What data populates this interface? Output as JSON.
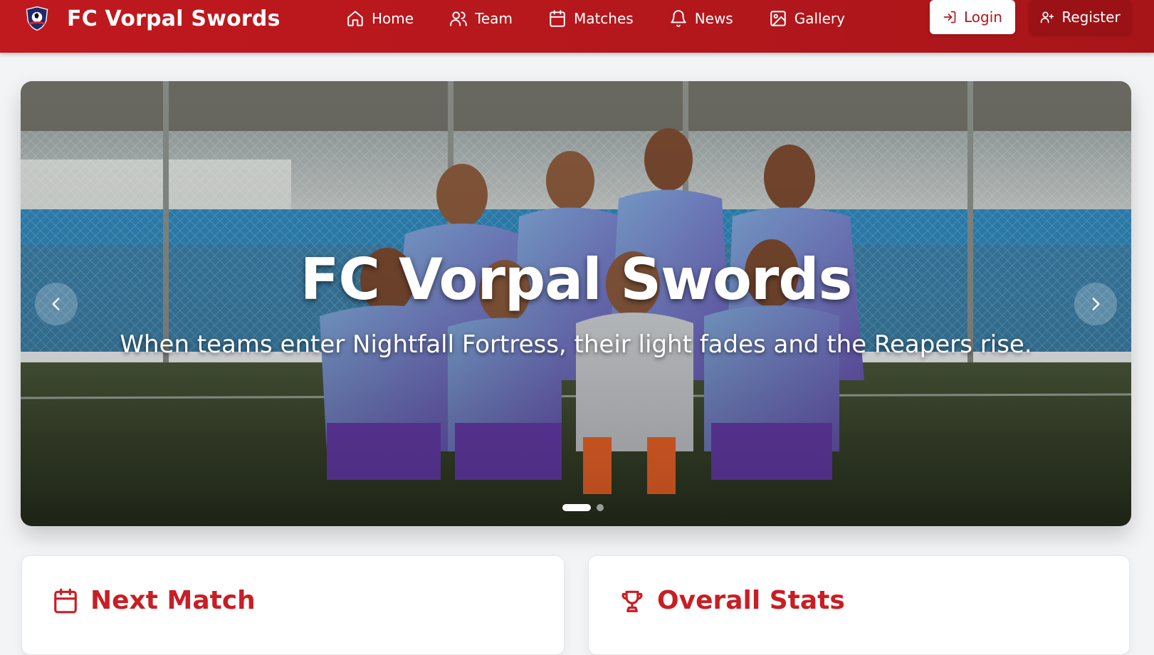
{
  "brand": {
    "name": "FC Vorpal Swords",
    "logo_icon": "club-crest-icon"
  },
  "nav": {
    "items": [
      {
        "label": "Home",
        "icon": "home-icon"
      },
      {
        "label": "Team",
        "icon": "users-icon"
      },
      {
        "label": "Matches",
        "icon": "calendar-icon"
      },
      {
        "label": "News",
        "icon": "bell-icon"
      },
      {
        "label": "Gallery",
        "icon": "image-icon"
      }
    ]
  },
  "auth": {
    "login_label": "Login",
    "register_label": "Register"
  },
  "hero": {
    "title": "FC Vorpal Swords",
    "subtitle": "When teams enter Nightfall Fortress, their light fades and the Reapers rise.",
    "slide_count": 2,
    "active_slide": 1
  },
  "cards": {
    "next_match_title": "Next Match",
    "overall_stats_title": "Overall Stats"
  },
  "colors": {
    "primary": "#c0191e",
    "primary_dark": "#9b1216",
    "accent_text": "#c81e24",
    "background": "#f3f4f6"
  }
}
